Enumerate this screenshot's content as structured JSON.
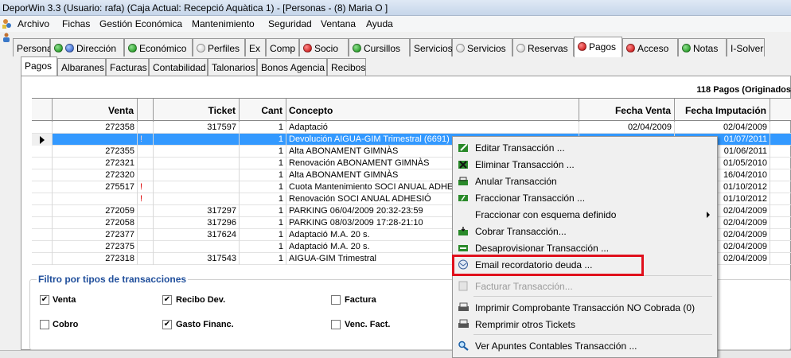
{
  "window": {
    "title": "DeporWin 3.3  (Usuario: rafa)  (Caja Actual: Recepció Aquàtica 1) - [Personas - (8) Maria O ]"
  },
  "menu": [
    "Archivo",
    "Fichas",
    "Gestión Económica",
    "Mantenimiento",
    "Seguridad",
    "Ventana",
    "Ayuda"
  ],
  "tabs": [
    {
      "label": "Personal",
      "dot": "none"
    },
    {
      "label": "Dirección",
      "dot": "green-blue"
    },
    {
      "label": "Económico",
      "dot": "green"
    },
    {
      "label": "Perfiles",
      "dot": "gray"
    },
    {
      "label": "Ex",
      "dot": "none"
    },
    {
      "label": "Comp",
      "dot": "none"
    },
    {
      "label": "Socio",
      "dot": "red"
    },
    {
      "label": "Cursillos",
      "dot": "green"
    },
    {
      "label": "Servicios",
      "dot": "none"
    },
    {
      "label": "Servicios",
      "dot": "gray"
    },
    {
      "label": "Reservas",
      "dot": "gray"
    },
    {
      "label": "Pagos",
      "dot": "red"
    },
    {
      "label": "Acceso",
      "dot": "red"
    },
    {
      "label": "Notas",
      "dot": "green"
    },
    {
      "label": "I-Solver",
      "dot": "none"
    }
  ],
  "subtabs": [
    "Pagos",
    "Albaranes",
    "Facturas",
    "Contabilidad",
    "Talonarios",
    "Bonos Agencia",
    "Recibos"
  ],
  "grid": {
    "count_label": "118 Pagos (Originados",
    "columns": [
      "Venta",
      "",
      "Ticket",
      "Cant",
      "Concepto",
      "Fecha Venta",
      "Fecha Imputación"
    ],
    "rows": [
      {
        "venta": "272358",
        "flag": "",
        "ticket": "317597",
        "cant": "1",
        "concepto": "Adaptació",
        "fecha_venta": "02/04/2009",
        "fecha_imp": "02/04/2009",
        "selected": false
      },
      {
        "venta": "",
        "flag": "!",
        "ticket": "",
        "cant": "1",
        "concepto": "Devolución AIGUA-GIM Trimestral (6691)",
        "fecha_venta": "",
        "fecha_imp": "01/07/2011",
        "selected": true
      },
      {
        "venta": "272355",
        "flag": "",
        "ticket": "",
        "cant": "1",
        "concepto": "Alta ABONAMENT GIMNÀS",
        "fecha_venta": "",
        "fecha_imp": "01/06/2011",
        "selected": false
      },
      {
        "venta": "272321",
        "flag": "",
        "ticket": "",
        "cant": "1",
        "concepto": "Renovación ABONAMENT GIMNÀS",
        "fecha_venta": "",
        "fecha_imp": "01/05/2010",
        "selected": false
      },
      {
        "venta": "272320",
        "flag": "",
        "ticket": "",
        "cant": "1",
        "concepto": "Alta ABONAMENT GIMNÀS",
        "fecha_venta": "",
        "fecha_imp": "16/04/2010",
        "selected": false
      },
      {
        "venta": "275517",
        "flag": "!",
        "ticket": "",
        "cant": "1",
        "concepto": "Cuota Mantenimiento SOCI ANUAL ADHES",
        "fecha_venta": "",
        "fecha_imp": "01/10/2012",
        "selected": false
      },
      {
        "venta": "",
        "flag": "!",
        "ticket": "",
        "cant": "1",
        "concepto": "Renovación SOCI ANUAL ADHESIÓ",
        "fecha_venta": "",
        "fecha_imp": "01/10/2012",
        "selected": false
      },
      {
        "venta": "272059",
        "flag": "",
        "ticket": "317297",
        "cant": "1",
        "concepto": "PARKING 06/04/2009 20:32-23:59",
        "fecha_venta": "",
        "fecha_imp": "02/04/2009",
        "selected": false
      },
      {
        "venta": "272058",
        "flag": "",
        "ticket": "317296",
        "cant": "1",
        "concepto": "PARKING 08/03/2009 17:28-21:10",
        "fecha_venta": "",
        "fecha_imp": "02/04/2009",
        "selected": false
      },
      {
        "venta": "272377",
        "flag": "",
        "ticket": "317624",
        "cant": "1",
        "concepto": "Adaptació M.A. 20 s.",
        "fecha_venta": "",
        "fecha_imp": "02/04/2009",
        "selected": false
      },
      {
        "venta": "272375",
        "flag": "",
        "ticket": "",
        "cant": "1",
        "concepto": "Adaptació M.A. 20 s.",
        "fecha_venta": "",
        "fecha_imp": "02/04/2009",
        "selected": false
      },
      {
        "venta": "272318",
        "flag": "",
        "ticket": "317543",
        "cant": "1",
        "concepto": "AIGUA-GIM Trimestral",
        "fecha_venta": "",
        "fecha_imp": "02/04/2009",
        "selected": false
      }
    ]
  },
  "filter": {
    "title": "Filtro por tipos de transacciones",
    "items": [
      {
        "label": "Venta",
        "checked": true
      },
      {
        "label": "Recibo Dev.",
        "checked": true
      },
      {
        "label": "Factura",
        "checked": false
      },
      {
        "label": "Cobro",
        "checked": false
      },
      {
        "label": "Gasto Financ.",
        "checked": true
      },
      {
        "label": "Venc. Fact.",
        "checked": false
      }
    ]
  },
  "context_menu": {
    "items": [
      {
        "label": "Editar Transacción ...",
        "icon": "edit-icon",
        "disabled": false
      },
      {
        "label": "Eliminar Transacción ...",
        "icon": "delete-icon",
        "disabled": false
      },
      {
        "label": "Anular Transacción",
        "icon": "cancel-icon",
        "disabled": false
      },
      {
        "label": "Fraccionar Transacción ...",
        "icon": "split-icon",
        "disabled": false
      },
      {
        "label": "Fraccionar con esquema definido",
        "icon": "",
        "disabled": false,
        "submenu": true
      },
      {
        "label": "Cobrar Transacción...",
        "icon": "cash-icon",
        "disabled": false
      },
      {
        "label": "Desaprovisionar Transacción ...",
        "icon": "unprovision-icon",
        "disabled": false
      },
      {
        "label": "Email recordatorio deuda ...",
        "icon": "email-icon",
        "disabled": false,
        "highlighted": true
      },
      {
        "label": "Facturar Transacción...",
        "icon": "invoice-icon",
        "disabled": true
      },
      {
        "label": "Imprimir Comprobante Transacción NO Cobrada (0)",
        "icon": "print-icon",
        "disabled": false
      },
      {
        "label": "Remprimir otros Tickets",
        "icon": "reprint-icon",
        "disabled": false
      },
      {
        "label": "Ver Apuntes Contables Transacción ...",
        "icon": "search-icon",
        "disabled": false
      }
    ],
    "highlight_color": "#e0101c"
  }
}
